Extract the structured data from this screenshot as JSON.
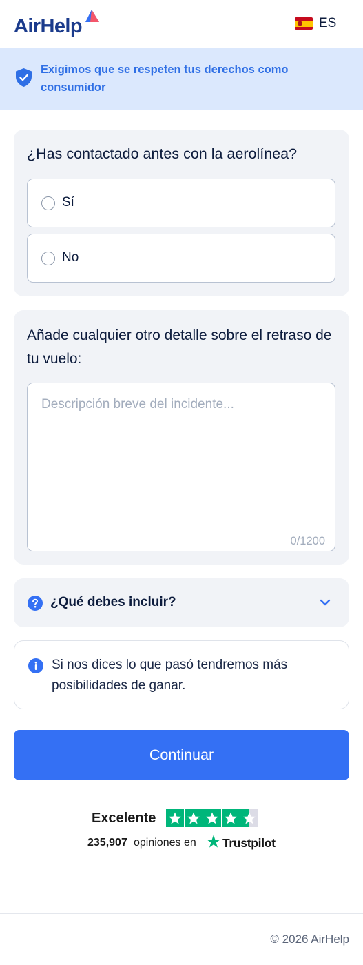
{
  "header": {
    "logo_text": "AirHelp",
    "language_code": "ES"
  },
  "banner": {
    "text": "Exigimos que se respeten tus derechos como consumidor"
  },
  "contact_question": {
    "title": "¿Has contactado antes con la aerolínea?",
    "options": [
      {
        "label": "Sí",
        "selected": false
      },
      {
        "label": "No",
        "selected": false
      }
    ]
  },
  "details": {
    "title": "Añade cualquier otro detalle sobre el retraso de tu vuelo:",
    "placeholder": "Descripción breve del incidente...",
    "value": "",
    "counter": "0/1200"
  },
  "accordion": {
    "label": "¿Qué debes incluir?",
    "expanded": false
  },
  "info": {
    "text": "Si nos dices lo que pasó tendremos más posibilidades de ganar."
  },
  "continue_button": {
    "label": "Continuar"
  },
  "trustpilot": {
    "rating_label": "Excelente",
    "stars": 4.5,
    "review_count": "235,907",
    "reviews_text": "opiniones en",
    "brand": "Trustpilot"
  },
  "footer": {
    "copyright": "© 2026 AirHelp"
  },
  "colors": {
    "brand_blue": "#1b3b8c",
    "accent_blue": "#3470f4",
    "banner_bg": "#dbe8fd",
    "card_bg": "#f1f3f7",
    "trustpilot_green": "#00b67a"
  }
}
